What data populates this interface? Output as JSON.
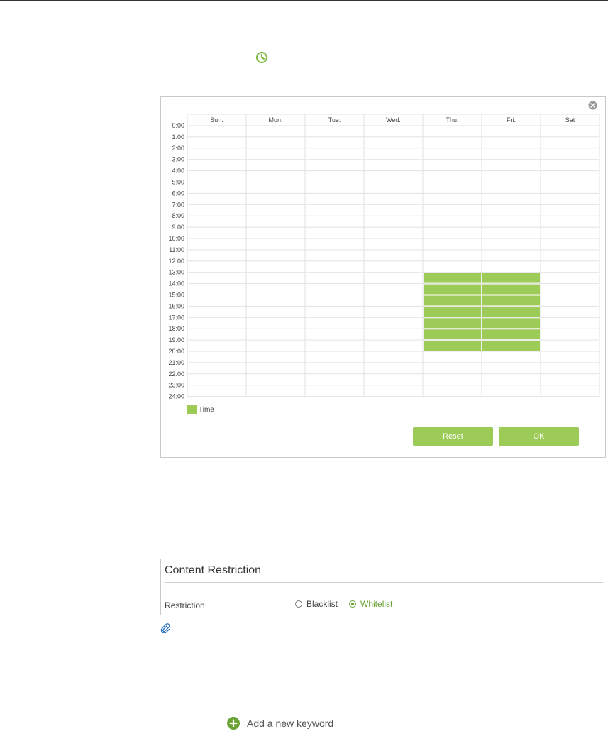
{
  "schedule": {
    "days": [
      "Sun.",
      "Mon.",
      "Tue.",
      "Wed.",
      "Thu.",
      "Fri.",
      "Sat"
    ],
    "hours": [
      "0:00",
      "1:00",
      "2:00",
      "3:00",
      "4:00",
      "5:00",
      "6:00",
      "7:00",
      "8:00",
      "9:00",
      "10:00",
      "11:00",
      "12:00",
      "13:00",
      "14:00",
      "15:00",
      "16:00",
      "17:00",
      "18:00",
      "19:00",
      "20:00",
      "21:00",
      "22:00",
      "23:00",
      "24:00"
    ],
    "selected": [
      {
        "day": "Thu.",
        "from": "13:00",
        "to": "20:00"
      },
      {
        "day": "Fri.",
        "from": "13:00",
        "to": "20:00"
      }
    ],
    "legend_label": "Time",
    "reset_label": "Reset",
    "ok_label": "OK",
    "accent_color": "#9ccb58"
  },
  "content_restriction": {
    "title": "Content Restriction",
    "restriction_label": "Restriction",
    "options": [
      {
        "label": "Blacklist",
        "checked": false
      },
      {
        "label": "Whitelist",
        "checked": true
      }
    ],
    "active_color": "#6aa334"
  },
  "add_keyword": {
    "label": "Add a new keyword"
  },
  "icons": [
    "clock-icon",
    "close-icon",
    "paperclip-icon",
    "plus-circle-icon"
  ]
}
